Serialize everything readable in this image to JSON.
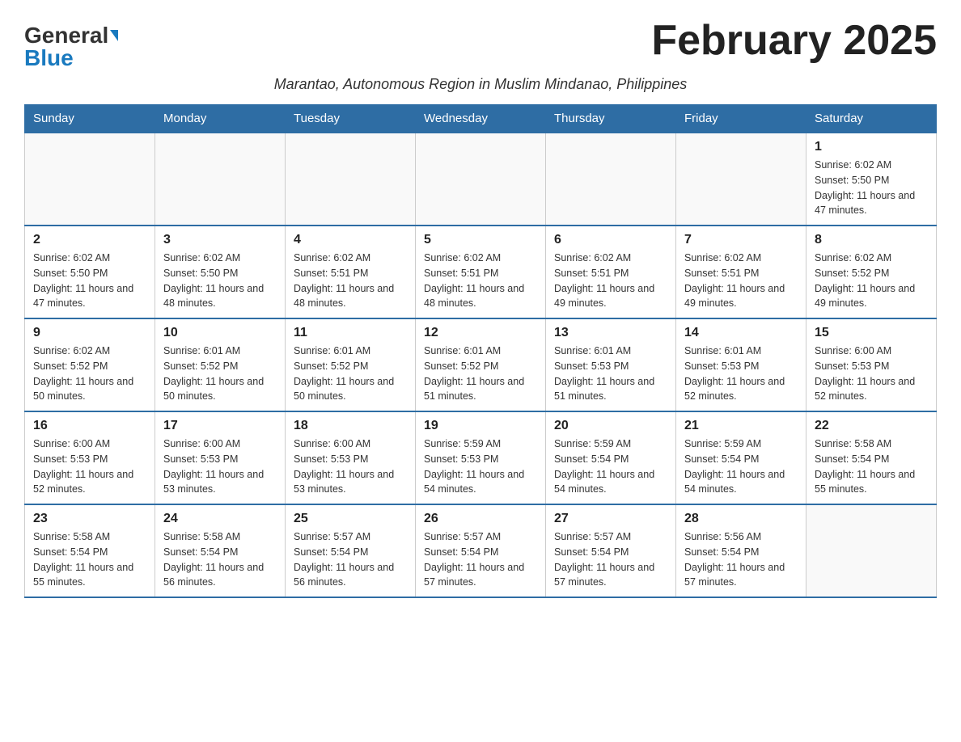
{
  "header": {
    "logo_general": "General",
    "logo_blue": "Blue",
    "month_title": "February 2025",
    "subtitle": "Marantao, Autonomous Region in Muslim Mindanao, Philippines"
  },
  "weekdays": [
    "Sunday",
    "Monday",
    "Tuesday",
    "Wednesday",
    "Thursday",
    "Friday",
    "Saturday"
  ],
  "weeks": [
    [
      {
        "day": "",
        "info": ""
      },
      {
        "day": "",
        "info": ""
      },
      {
        "day": "",
        "info": ""
      },
      {
        "day": "",
        "info": ""
      },
      {
        "day": "",
        "info": ""
      },
      {
        "day": "",
        "info": ""
      },
      {
        "day": "1",
        "info": "Sunrise: 6:02 AM\nSunset: 5:50 PM\nDaylight: 11 hours and 47 minutes."
      }
    ],
    [
      {
        "day": "2",
        "info": "Sunrise: 6:02 AM\nSunset: 5:50 PM\nDaylight: 11 hours and 47 minutes."
      },
      {
        "day": "3",
        "info": "Sunrise: 6:02 AM\nSunset: 5:50 PM\nDaylight: 11 hours and 48 minutes."
      },
      {
        "day": "4",
        "info": "Sunrise: 6:02 AM\nSunset: 5:51 PM\nDaylight: 11 hours and 48 minutes."
      },
      {
        "day": "5",
        "info": "Sunrise: 6:02 AM\nSunset: 5:51 PM\nDaylight: 11 hours and 48 minutes."
      },
      {
        "day": "6",
        "info": "Sunrise: 6:02 AM\nSunset: 5:51 PM\nDaylight: 11 hours and 49 minutes."
      },
      {
        "day": "7",
        "info": "Sunrise: 6:02 AM\nSunset: 5:51 PM\nDaylight: 11 hours and 49 minutes."
      },
      {
        "day": "8",
        "info": "Sunrise: 6:02 AM\nSunset: 5:52 PM\nDaylight: 11 hours and 49 minutes."
      }
    ],
    [
      {
        "day": "9",
        "info": "Sunrise: 6:02 AM\nSunset: 5:52 PM\nDaylight: 11 hours and 50 minutes."
      },
      {
        "day": "10",
        "info": "Sunrise: 6:01 AM\nSunset: 5:52 PM\nDaylight: 11 hours and 50 minutes."
      },
      {
        "day": "11",
        "info": "Sunrise: 6:01 AM\nSunset: 5:52 PM\nDaylight: 11 hours and 50 minutes."
      },
      {
        "day": "12",
        "info": "Sunrise: 6:01 AM\nSunset: 5:52 PM\nDaylight: 11 hours and 51 minutes."
      },
      {
        "day": "13",
        "info": "Sunrise: 6:01 AM\nSunset: 5:53 PM\nDaylight: 11 hours and 51 minutes."
      },
      {
        "day": "14",
        "info": "Sunrise: 6:01 AM\nSunset: 5:53 PM\nDaylight: 11 hours and 52 minutes."
      },
      {
        "day": "15",
        "info": "Sunrise: 6:00 AM\nSunset: 5:53 PM\nDaylight: 11 hours and 52 minutes."
      }
    ],
    [
      {
        "day": "16",
        "info": "Sunrise: 6:00 AM\nSunset: 5:53 PM\nDaylight: 11 hours and 52 minutes."
      },
      {
        "day": "17",
        "info": "Sunrise: 6:00 AM\nSunset: 5:53 PM\nDaylight: 11 hours and 53 minutes."
      },
      {
        "day": "18",
        "info": "Sunrise: 6:00 AM\nSunset: 5:53 PM\nDaylight: 11 hours and 53 minutes."
      },
      {
        "day": "19",
        "info": "Sunrise: 5:59 AM\nSunset: 5:53 PM\nDaylight: 11 hours and 54 minutes."
      },
      {
        "day": "20",
        "info": "Sunrise: 5:59 AM\nSunset: 5:54 PM\nDaylight: 11 hours and 54 minutes."
      },
      {
        "day": "21",
        "info": "Sunrise: 5:59 AM\nSunset: 5:54 PM\nDaylight: 11 hours and 54 minutes."
      },
      {
        "day": "22",
        "info": "Sunrise: 5:58 AM\nSunset: 5:54 PM\nDaylight: 11 hours and 55 minutes."
      }
    ],
    [
      {
        "day": "23",
        "info": "Sunrise: 5:58 AM\nSunset: 5:54 PM\nDaylight: 11 hours and 55 minutes."
      },
      {
        "day": "24",
        "info": "Sunrise: 5:58 AM\nSunset: 5:54 PM\nDaylight: 11 hours and 56 minutes."
      },
      {
        "day": "25",
        "info": "Sunrise: 5:57 AM\nSunset: 5:54 PM\nDaylight: 11 hours and 56 minutes."
      },
      {
        "day": "26",
        "info": "Sunrise: 5:57 AM\nSunset: 5:54 PM\nDaylight: 11 hours and 57 minutes."
      },
      {
        "day": "27",
        "info": "Sunrise: 5:57 AM\nSunset: 5:54 PM\nDaylight: 11 hours and 57 minutes."
      },
      {
        "day": "28",
        "info": "Sunrise: 5:56 AM\nSunset: 5:54 PM\nDaylight: 11 hours and 57 minutes."
      },
      {
        "day": "",
        "info": ""
      }
    ]
  ]
}
